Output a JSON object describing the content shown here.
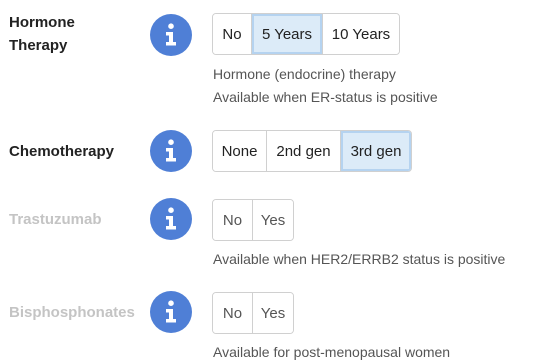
{
  "rows": [
    {
      "label": "Hormone Therapy",
      "label_line1": "Hormone",
      "label_line2": "Therapy",
      "enabled": true,
      "options": [
        "No",
        "5 Years",
        "10 Years"
      ],
      "selected": "5 Years",
      "help": [
        "Hormone (endocrine) therapy",
        "Available when ER-status is positive"
      ]
    },
    {
      "label": "Chemotherapy",
      "enabled": true,
      "options": [
        "None",
        "2nd gen",
        "3rd gen"
      ],
      "selected": "3rd gen",
      "help": []
    },
    {
      "label": "Trastuzumab",
      "enabled": false,
      "options": [
        "No",
        "Yes"
      ],
      "selected": "",
      "help": [
        "Available when HER2/ERRB2 status is positive"
      ]
    },
    {
      "label": "Bisphosphonates",
      "enabled": false,
      "options": [
        "No",
        "Yes"
      ],
      "selected": "",
      "help": [
        "Available for post-menopausal women"
      ]
    }
  ],
  "icon": "info-icon",
  "colors": {
    "icon_blue": "#4f7fd6",
    "selected_bg": "#dcebf8",
    "disabled_label": "#c4c4c4"
  }
}
